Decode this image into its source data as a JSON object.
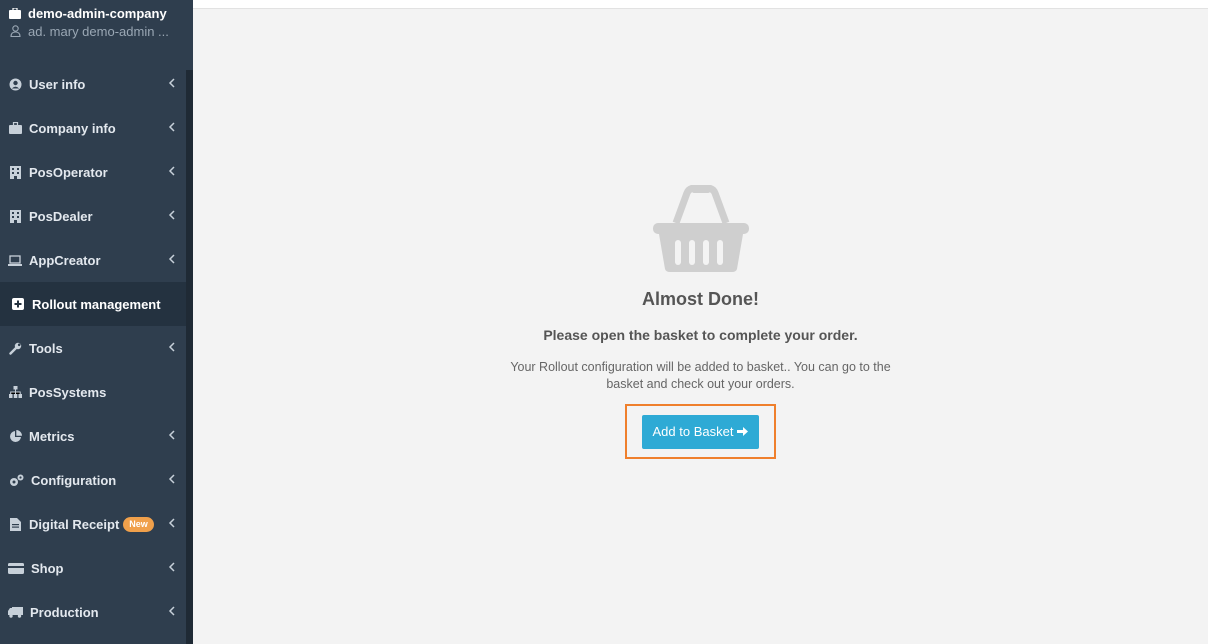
{
  "header": {
    "company": "demo-admin-company",
    "user": "ad. mary demo-admin ..."
  },
  "sidebar": {
    "items": [
      {
        "label": "User info",
        "icon": "user-circle-icon",
        "chevron": true
      },
      {
        "label": "Company info",
        "icon": "briefcase-icon",
        "chevron": true
      },
      {
        "label": "PosOperator",
        "icon": "building-icon",
        "chevron": true
      },
      {
        "label": "PosDealer",
        "icon": "building-icon",
        "chevron": true
      },
      {
        "label": "AppCreator",
        "icon": "laptop-icon",
        "chevron": true
      },
      {
        "label": "Rollout management",
        "icon": "plus-square-icon",
        "chevron": false,
        "active": true
      },
      {
        "label": "Tools",
        "icon": "wrench-icon",
        "chevron": true
      },
      {
        "label": "PosSystems",
        "icon": "sitemap-icon",
        "chevron": false
      },
      {
        "label": "Metrics",
        "icon": "pie-chart-icon",
        "chevron": true
      },
      {
        "label": "Configuration",
        "icon": "cogs-icon",
        "chevron": true
      },
      {
        "label": "Digital Receipt",
        "icon": "file-icon",
        "chevron": true,
        "badge": "New"
      },
      {
        "label": "Shop",
        "icon": "credit-card-icon",
        "chevron": true
      },
      {
        "label": "Production",
        "icon": "truck-icon",
        "chevron": true
      }
    ]
  },
  "main": {
    "icon": "shopping-basket-icon",
    "title": "Almost Done!",
    "subtitle": "Please open the basket to complete your order.",
    "description": "Your Rollout configuration will be added to basket.. You can go to the basket and check out your orders.",
    "button_label": "Add to Basket"
  },
  "colors": {
    "sidebar_bg": "#2f3e4e",
    "active_item_bg": "#243240",
    "button_bg": "#2eaad5",
    "highlight_border": "#ef7f2c",
    "badge_bg": "#f0a04b"
  }
}
